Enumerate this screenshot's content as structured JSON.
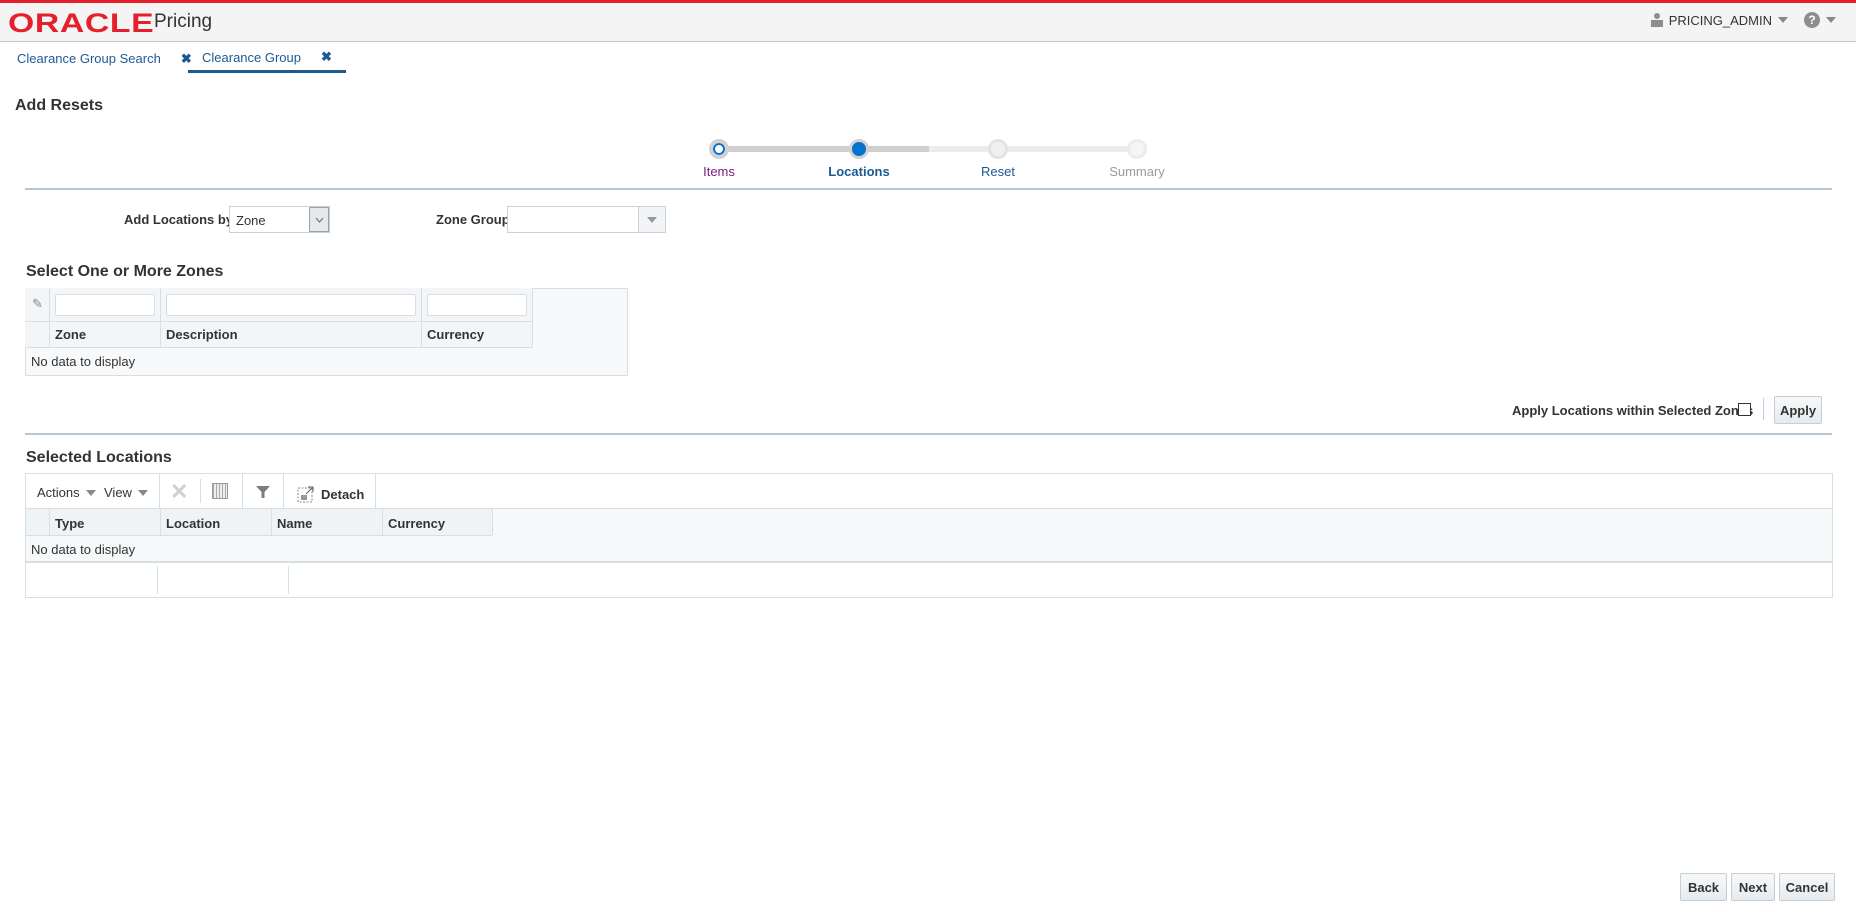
{
  "header": {
    "logo": "ORACLE",
    "app_name": "Pricing",
    "user": "PRICING_ADMIN",
    "help_icon": "?",
    "brand_color": "#e4202c"
  },
  "tabs": [
    {
      "label": "Clearance Group Search",
      "active": false
    },
    {
      "label": "Clearance Group",
      "active": true
    }
  ],
  "page_title": "Add Resets",
  "train": {
    "steps": [
      {
        "label": "Items",
        "state": "visited"
      },
      {
        "label": "Locations",
        "state": "current"
      },
      {
        "label": "Reset",
        "state": "next"
      },
      {
        "label": "Summary",
        "state": "disabled"
      }
    ]
  },
  "form": {
    "add_locations_by_label": "Add Locations by",
    "add_locations_by_value": "Zone",
    "zone_group_label": "Zone Group",
    "zone_group_value": ""
  },
  "zones": {
    "title": "Select One or More Zones",
    "columns": [
      "Zone",
      "Description",
      "Currency"
    ],
    "empty_text": "No data to display"
  },
  "apply_row": {
    "checkbox_label": "Apply Locations within Selected Zones",
    "checked": false,
    "apply_button": "Apply"
  },
  "selected_locations": {
    "title": "Selected Locations",
    "toolbar": {
      "actions": "Actions",
      "view": "View",
      "detach": "Detach"
    },
    "columns": [
      "Type",
      "Location",
      "Name",
      "Currency"
    ],
    "empty_text": "No data to display"
  },
  "footer": {
    "back": "Back",
    "next": "Next",
    "cancel": "Cancel"
  }
}
